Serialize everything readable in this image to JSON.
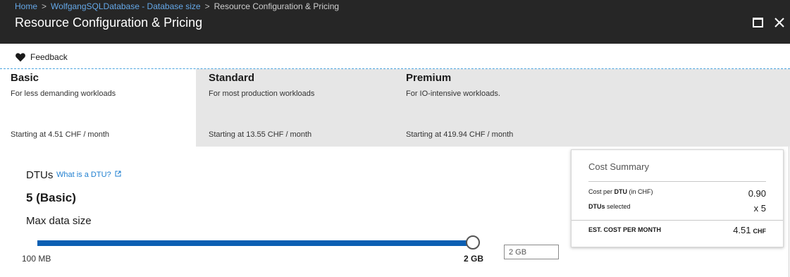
{
  "breadcrumb": {
    "items": [
      "Home",
      "WolfgangSQLDatabase - Database size",
      "Resource Configuration & Pricing"
    ],
    "separator": ">"
  },
  "blade": {
    "title": "Resource Configuration & Pricing"
  },
  "toolbar": {
    "feedback_label": "Feedback"
  },
  "tiers": [
    {
      "name": "Basic",
      "description": "For less demanding workloads",
      "price": "Starting at 4.51 CHF / month",
      "selected": true
    },
    {
      "name": "Standard",
      "description": "For most production workloads",
      "price": "Starting at 13.55 CHF / month",
      "selected": false
    },
    {
      "name": "Premium",
      "description": "For IO-intensive workloads.",
      "price": "Starting at 419.94 CHF / month",
      "selected": false
    }
  ],
  "dtu": {
    "label": "DTUs",
    "help_link": "What is a DTU?",
    "value": "5 (Basic)"
  },
  "max_data_size": {
    "label": "Max data size",
    "min_label": "100 MB",
    "max_label": "2 GB",
    "slider_fraction": 1.0,
    "input_value": "2 GB"
  },
  "cost_summary": {
    "title": "Cost Summary",
    "cost_per_dtu_prefix": "Cost per",
    "cost_per_dtu_bold": "DTU",
    "cost_per_dtu_suffix": "(in CHF)",
    "cost_per_dtu_value": "0.90",
    "dtus_selected_bold": "DTUs",
    "dtus_selected_suffix": "selected",
    "dtus_selected_value": "x 5",
    "est_label": "EST. COST PER MONTH",
    "est_value": "4.51",
    "est_unit": "CHF"
  },
  "colors": {
    "header_bg": "#262626",
    "link": "#65a8e8",
    "slider_fill": "#0b5fb3",
    "tier_unselected_bg": "#e6e6e6"
  }
}
